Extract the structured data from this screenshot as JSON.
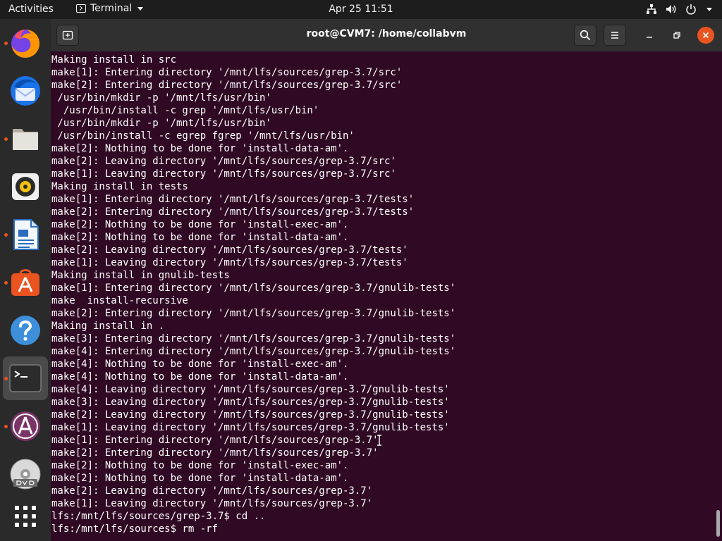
{
  "topbar": {
    "activities": "Activities",
    "app_name": "Terminal",
    "clock": "Apr 25  11:51"
  },
  "dock": {
    "items": [
      {
        "name": "firefox-icon",
        "running": true
      },
      {
        "name": "thunderbird-icon",
        "running": false
      },
      {
        "name": "files-icon",
        "running": true
      },
      {
        "name": "rhythmbox-icon",
        "running": false
      },
      {
        "name": "libreoffice-writer-icon",
        "running": true
      },
      {
        "name": "ubuntu-software-icon",
        "running": true
      },
      {
        "name": "help-icon",
        "running": false
      },
      {
        "name": "terminal-icon",
        "running": true,
        "active": true
      },
      {
        "name": "software-updater-icon",
        "running": true
      },
      {
        "name": "dvd-icon",
        "running": false
      },
      {
        "name": "show-applications-icon",
        "running": false
      }
    ]
  },
  "window": {
    "title": "root@CVM7: /home/collabvm"
  },
  "terminal": {
    "lines": [
      "Making install in src",
      "make[1]: Entering directory '/mnt/lfs/sources/grep-3.7/src'",
      "make[2]: Entering directory '/mnt/lfs/sources/grep-3.7/src'",
      " /usr/bin/mkdir -p '/mnt/lfs/usr/bin'",
      "  /usr/bin/install -c grep '/mnt/lfs/usr/bin'",
      " /usr/bin/mkdir -p '/mnt/lfs/usr/bin'",
      " /usr/bin/install -c egrep fgrep '/mnt/lfs/usr/bin'",
      "make[2]: Nothing to be done for 'install-data-am'.",
      "make[2]: Leaving directory '/mnt/lfs/sources/grep-3.7/src'",
      "make[1]: Leaving directory '/mnt/lfs/sources/grep-3.7/src'",
      "Making install in tests",
      "make[1]: Entering directory '/mnt/lfs/sources/grep-3.7/tests'",
      "make[2]: Entering directory '/mnt/lfs/sources/grep-3.7/tests'",
      "make[2]: Nothing to be done for 'install-exec-am'.",
      "make[2]: Nothing to be done for 'install-data-am'.",
      "make[2]: Leaving directory '/mnt/lfs/sources/grep-3.7/tests'",
      "make[1]: Leaving directory '/mnt/lfs/sources/grep-3.7/tests'",
      "Making install in gnulib-tests",
      "make[1]: Entering directory '/mnt/lfs/sources/grep-3.7/gnulib-tests'",
      "make  install-recursive",
      "make[2]: Entering directory '/mnt/lfs/sources/grep-3.7/gnulib-tests'",
      "Making install in .",
      "make[3]: Entering directory '/mnt/lfs/sources/grep-3.7/gnulib-tests'",
      "make[4]: Entering directory '/mnt/lfs/sources/grep-3.7/gnulib-tests'",
      "make[4]: Nothing to be done for 'install-exec-am'.",
      "make[4]: Nothing to be done for 'install-data-am'.",
      "make[4]: Leaving directory '/mnt/lfs/sources/grep-3.7/gnulib-tests'",
      "make[3]: Leaving directory '/mnt/lfs/sources/grep-3.7/gnulib-tests'",
      "make[2]: Leaving directory '/mnt/lfs/sources/grep-3.7/gnulib-tests'",
      "make[1]: Leaving directory '/mnt/lfs/sources/grep-3.7/gnulib-tests'",
      "make[1]: Entering directory '/mnt/lfs/sources/grep-3.7'",
      "make[2]: Entering directory '/mnt/lfs/sources/grep-3.7'",
      "make[2]: Nothing to be done for 'install-exec-am'.",
      "make[2]: Nothing to be done for 'install-data-am'.",
      "make[2]: Leaving directory '/mnt/lfs/sources/grep-3.7'",
      "make[1]: Leaving directory '/mnt/lfs/sources/grep-3.7'",
      "lfs:/mnt/lfs/sources/grep-3.7$ cd ..",
      "lfs:/mnt/lfs/sources$ rm -rf "
    ]
  },
  "colors": {
    "terminal_bg": "#300a24",
    "terminal_fg": "#ffffff",
    "accent": "#e95420",
    "close_button": "#e95420",
    "headerbar": "#303030",
    "topbar": "#1d1d1d"
  }
}
